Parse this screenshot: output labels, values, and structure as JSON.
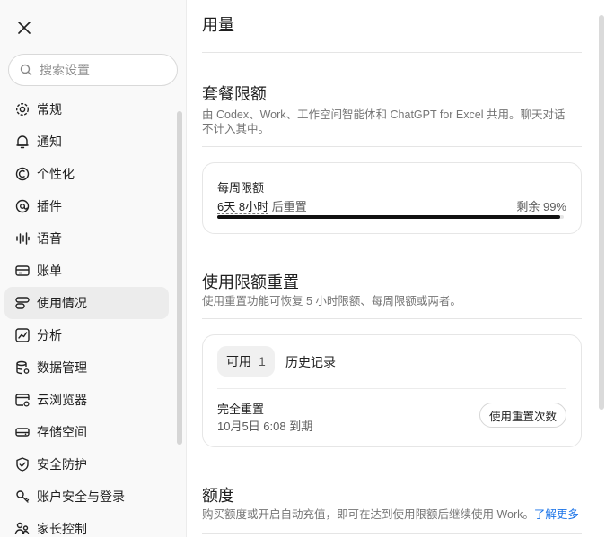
{
  "search": {
    "placeholder": "搜索设置"
  },
  "sidebar": {
    "items": [
      {
        "label": "常规",
        "icon": "gear-icon"
      },
      {
        "label": "通知",
        "icon": "bell-icon"
      },
      {
        "label": "个性化",
        "icon": "personalization-icon"
      },
      {
        "label": "插件",
        "icon": "plugin-icon"
      },
      {
        "label": "语音",
        "icon": "waveform-icon"
      },
      {
        "label": "账单",
        "icon": "card-icon"
      },
      {
        "label": "使用情况",
        "icon": "usage-icon",
        "active": true
      },
      {
        "label": "分析",
        "icon": "chart-icon"
      },
      {
        "label": "数据管理",
        "icon": "database-icon"
      },
      {
        "label": "云浏览器",
        "icon": "cloud-browser-icon"
      },
      {
        "label": "存储空间",
        "icon": "storage-icon"
      },
      {
        "label": "安全防护",
        "icon": "shield-icon"
      },
      {
        "label": "账户安全与登录",
        "icon": "account-security-icon"
      },
      {
        "label": "家长控制",
        "icon": "parental-control-icon"
      }
    ]
  },
  "main": {
    "title": "用量",
    "plan_limits": {
      "title": "套餐限额",
      "desc": "由 Codex、Work、工作空间智能体和 ChatGPT for Excel 共用。聊天对话不计入其中。",
      "weekly": {
        "label": "每周限额",
        "reset_time": "6天 8小时",
        "reset_suffix": "后重置",
        "remaining": "剩余 99%",
        "percent_used": 1
      }
    },
    "reset": {
      "title": "使用限额重置",
      "desc": "使用重置功能可恢复 5 小时限额、每周限额或两者。",
      "tab_available": "可用",
      "available_count": "1",
      "tab_history": "历史记录",
      "item_title": "完全重置",
      "item_expiry": "10月5日 6:08 到期",
      "button": "使用重置次数"
    },
    "credits": {
      "title": "额度",
      "desc": "购买额度或开启自动充值，即可在达到使用限额后继续使用 Work。",
      "link": "了解更多"
    }
  },
  "colors": {
    "accent_link": "#1a73e8",
    "active_bg": "#ececec",
    "bar": "#111111"
  }
}
